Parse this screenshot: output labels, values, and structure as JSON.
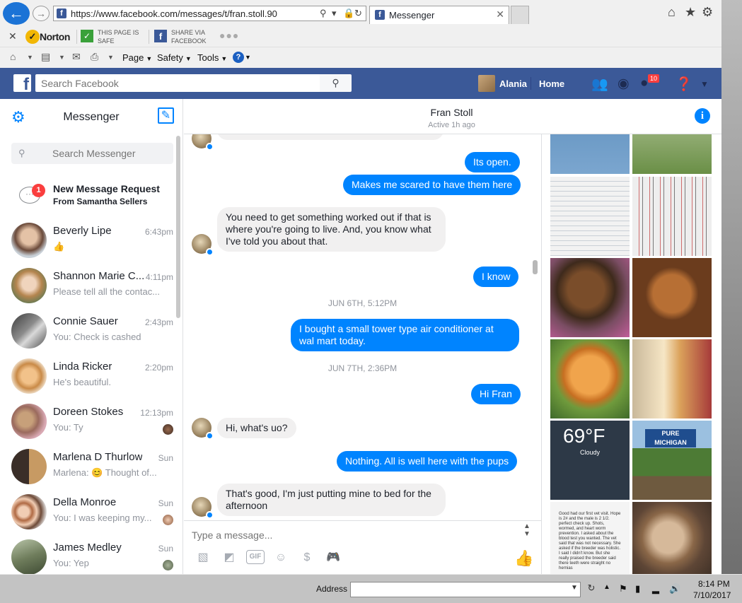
{
  "browser": {
    "url": "https://www.facebook.com/messages/t/fran.stoll.90",
    "tab_title": "Messenger",
    "toolbar": {
      "norton": "Norton",
      "safe_line1": "THIS PAGE IS",
      "safe_line2": "SAFE",
      "share_line1": "SHARE VIA",
      "share_line2": "FACEBOOK"
    },
    "commands": {
      "page": "Page",
      "safety": "Safety",
      "tools": "Tools"
    }
  },
  "facebook": {
    "search_placeholder": "Search Facebook",
    "user_name": "Alania",
    "home_label": "Home",
    "notification_count": "10"
  },
  "messenger": {
    "title": "Messenger",
    "search_placeholder": "Search Messenger",
    "request": {
      "title": "New Message Request",
      "subtitle": "From Samantha Sellers",
      "badge": "1"
    },
    "conversations": [
      {
        "name": "Beverly Lipe",
        "snippet": "👍",
        "time": "6:43pm"
      },
      {
        "name": "Shannon Marie C...",
        "snippet": "Please tell all the contac...",
        "time": "4:11pm"
      },
      {
        "name": "Connie Sauer",
        "snippet": "You: Check is cashed",
        "time": "2:43pm"
      },
      {
        "name": "Linda Ricker",
        "snippet": "He's beautiful.",
        "time": "2:20pm"
      },
      {
        "name": "Doreen Stokes",
        "snippet": "You: Ty",
        "time": "12:13pm"
      },
      {
        "name": "Marlena D Thurlow",
        "snippet": "Marlena: 😊 Thought of...",
        "time": "Sun"
      },
      {
        "name": "Della Monroe",
        "snippet": "You: I was keeping my...",
        "time": "Sun"
      },
      {
        "name": "James Medley",
        "snippet": "You: Yep",
        "time": "Sun"
      }
    ]
  },
  "thread": {
    "contact_name": "Fran Stoll",
    "status": "Active 1h ago",
    "messages": [
      {
        "from": "me",
        "text": "Its open."
      },
      {
        "from": "me",
        "text": "Makes me scared to have them here"
      },
      {
        "from": "them",
        "text": "You need to get something worked out if that is where you're going to live.  And, you know what I've told you about that."
      },
      {
        "from": "me",
        "text": "I know"
      },
      {
        "from": "timestamp",
        "text": "JUN 6TH, 5:12PM"
      },
      {
        "from": "me",
        "text": "I bought a small tower type air conditioner at wal mart today."
      },
      {
        "from": "timestamp",
        "text": "JUN 7TH, 2:36PM"
      },
      {
        "from": "me",
        "text": "Hi Fran"
      },
      {
        "from": "them",
        "text": "Hi, what's uo?"
      },
      {
        "from": "me",
        "text": "Nothing. All is well here with the pups"
      },
      {
        "from": "them",
        "text": "That's  good,  I'm just putting mine to bed for the afternoon"
      }
    ],
    "composer_placeholder": "Type a message..."
  },
  "photos": {
    "weather_temp": "69°F",
    "weather_desc": "Cloudy",
    "michigan_sign": "PURE MICHIGAN",
    "text_screenshot": "Good had our first vet visit. Hope is 2# and the male is 2 1/2. perfect check up. Shots, wormed, and heart worm prevention. I asked about the blood test you wanted. The vet said that was not necessary. She asked if the breeder was holistic. I said I didn't know. But she really praised the breeder said there teeth were straight no hernias"
  },
  "taskbar": {
    "address_label": "Address",
    "time": "8:14 PM",
    "date": "7/10/2017"
  },
  "colors": {
    "facebook_blue": "#3b5998",
    "messenger_blue": "#0084ff",
    "bubble_gray": "#f1f0f0"
  }
}
